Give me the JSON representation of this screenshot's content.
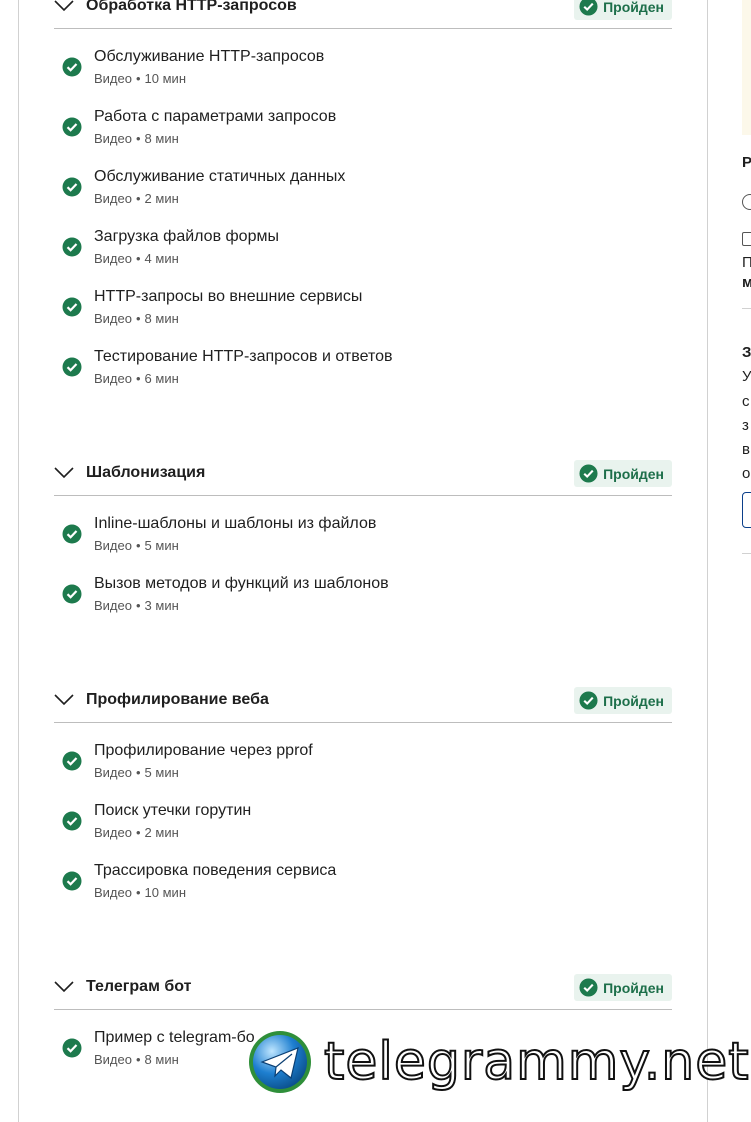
{
  "modules": [
    {
      "title": "Обработка HTTP-запросов",
      "badge": "Пройден",
      "items": [
        {
          "title": "Обслуживание HTTP-запросов",
          "type": "Видео",
          "duration": "10 мин"
        },
        {
          "title": "Работа с параметрами запросов",
          "type": "Видео",
          "duration": "8 мин"
        },
        {
          "title": "Обслуживание статичных данных",
          "type": "Видео",
          "duration": "2 мин"
        },
        {
          "title": "Загрузка файлов формы",
          "type": "Видео",
          "duration": "4 мин"
        },
        {
          "title": "HTTP-запросы во внешние сервисы",
          "type": "Видео",
          "duration": "8 мин"
        },
        {
          "title": "Тестирование HTTP-запросов и ответов",
          "type": "Видео",
          "duration": "6 мин"
        }
      ]
    },
    {
      "title": "Шаблонизация",
      "badge": "Пройден",
      "items": [
        {
          "title": "Inline-шаблоны и шаблоны из файлов",
          "type": "Видео",
          "duration": "5 мин"
        },
        {
          "title": "Вызов методов и функций из шаблонов",
          "type": "Видео",
          "duration": "3 мин"
        }
      ]
    },
    {
      "title": "Профилирование веба",
      "badge": "Пройден",
      "items": [
        {
          "title": "Профилирование через pprof",
          "type": "Видео",
          "duration": "5 мин"
        },
        {
          "title": "Поиск утечки горутин",
          "type": "Видео",
          "duration": "2 мин"
        },
        {
          "title": "Трассировка поведения сервиса",
          "type": "Видео",
          "duration": "10 мин"
        }
      ]
    },
    {
      "title": "Телеграм бот",
      "badge": "Пройден",
      "items": [
        {
          "title": "Пример с telegram-бо",
          "type": "Видео",
          "duration": "8 мин"
        }
      ]
    }
  ],
  "sidebar_fragments": {
    "r": "Р",
    "p": "П",
    "m": "м",
    "z": "З",
    "u": "У",
    "s": "с",
    "z2": "з",
    "v": "в",
    "o": "о"
  },
  "watermark": {
    "text": "telegrammy.net"
  },
  "colors": {
    "success": "#1d7a4d",
    "badge_bg": "#e9f3ee",
    "badge_text": "#1d6f4a"
  }
}
